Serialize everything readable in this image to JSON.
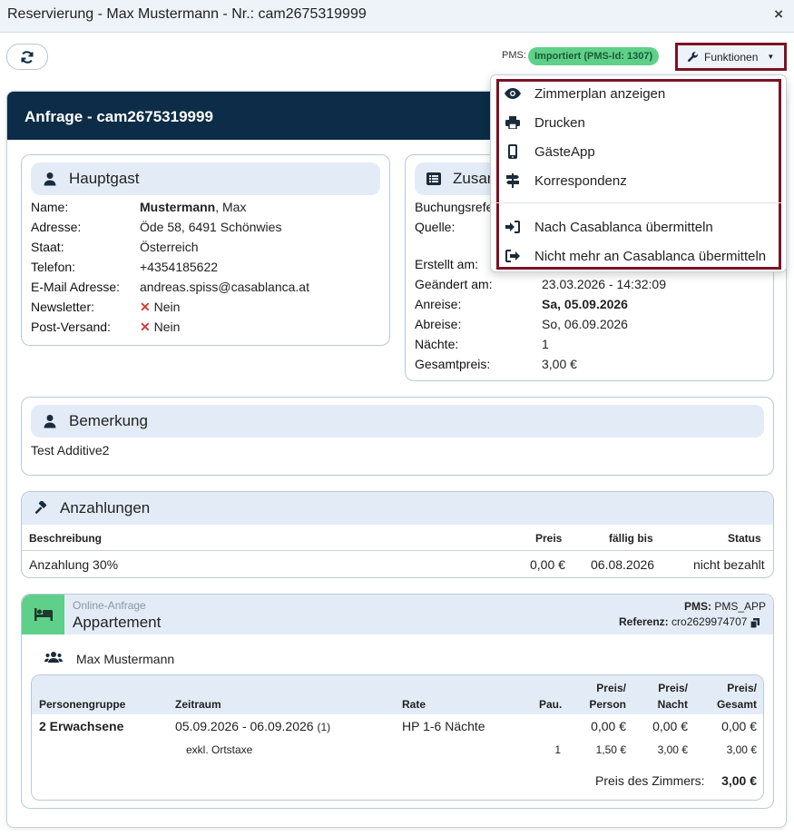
{
  "window": {
    "title": "Reservierung - Max Mustermann - Nr.: cam2675319999",
    "close": "×"
  },
  "toolbar": {
    "pms_label": "PMS:",
    "pms_badge": "Importiert (PMS-Id: 1307)",
    "functions_label": "Funktionen"
  },
  "functions_menu": {
    "items": [
      {
        "label": "Zimmerplan anzeigen",
        "icon": "eye-icon"
      },
      {
        "label": "Drucken",
        "icon": "printer-icon"
      },
      {
        "label": "GästeApp",
        "icon": "mobile-icon"
      },
      {
        "label": "Korrespondenz",
        "icon": "signpost-icon"
      },
      {
        "label": "Nach Casablanca übermitteln",
        "icon": "sign-in-icon"
      },
      {
        "label": "Nicht mehr an Casablanca übermitteln",
        "icon": "sign-out-icon"
      }
    ]
  },
  "request": {
    "header": "Anfrage - cam2675319999"
  },
  "guest": {
    "title": "Hauptgast",
    "rows": [
      {
        "key": "Name:",
        "value_bold": "Mustermann",
        "value": ", Max"
      },
      {
        "key": "Adresse:",
        "value": "Öde 58, 6491 Schönwies"
      },
      {
        "key": "Staat:",
        "value": "Österreich"
      },
      {
        "key": "Telefon:",
        "value": "+4354185622"
      },
      {
        "key": "E-Mail Adresse:",
        "value": "andreas.spiss@casablanca.at"
      },
      {
        "key": "Newsletter:",
        "value": "Nein"
      },
      {
        "key": "Post-Versand:",
        "value": "Nein"
      }
    ]
  },
  "additional": {
    "title": "Zusan",
    "rows": [
      {
        "key": "Buchungsrefe",
        "value": ""
      },
      {
        "key": "Quelle:",
        "value": ""
      },
      {
        "key": "Erstellt am:",
        "value": ""
      },
      {
        "key": "Geändert am:",
        "value": "23.03.2026 - 14:32:09"
      },
      {
        "key": "Anreise:",
        "value": "Sa, 05.09.2026"
      },
      {
        "key": "Abreise:",
        "value": "So, 06.09.2026"
      },
      {
        "key": "Nächte:",
        "value": "1"
      },
      {
        "key": "Gesamtpreis:",
        "value": "3,00 €"
      }
    ]
  },
  "remark": {
    "title": "Bemerkung",
    "text": "Test Additive2"
  },
  "deposits": {
    "title": "Anzahlungen",
    "columns": [
      "Beschreibung",
      "Preis",
      "fällig bis",
      "Status"
    ],
    "rows": [
      {
        "description": "Anzahlung 30%",
        "price": "0,00 €",
        "due": "06.08.2026",
        "status": "nicht bezahlt"
      }
    ]
  },
  "room": {
    "source": "Online-Anfrage",
    "title": "Appartement",
    "pms_label": "PMS:",
    "pms_value": "PMS_APP",
    "ref_label": "Referenz:",
    "ref_value": "cro2629974707",
    "guest_name": "Max Mustermann",
    "columns": {
      "group": "Personengruppe",
      "period": "Zeitraum",
      "rate": "Rate",
      "pau": "Pau.",
      "pp_1": "Preis/",
      "pp_2": "Person",
      "pn_1": "Preis/",
      "pn_2": "Nacht",
      "pt_1": "Preis/",
      "pt_2": "Gesamt"
    },
    "line": {
      "group": "2 Erwachsene",
      "period": "05.09.2026 - 06.09.2026",
      "period_count": "(1)",
      "rate": "HP 1-6 Nächte",
      "pp": "0,00 €",
      "pn": "0,00 €",
      "pt": "0,00 €"
    },
    "extra": {
      "label": "exkl. Ortstaxe",
      "pau": "1",
      "pp": "1,50 €",
      "pn": "3,00 €",
      "pt": "3,00 €"
    },
    "total_label": "Preis des Zimmers:",
    "total_value": "3,00 €"
  }
}
